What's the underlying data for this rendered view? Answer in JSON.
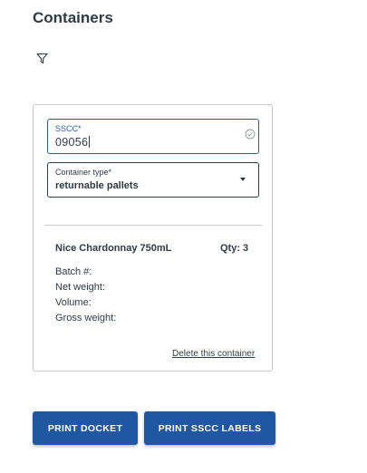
{
  "page": {
    "title": "Containers"
  },
  "card": {
    "sscc": {
      "label": "SSCC*",
      "value": "09056"
    },
    "container_type": {
      "label": "Container type*",
      "value": "returnable pallets"
    },
    "product": {
      "name": "Nice Chardonnay 750mL",
      "qty": "Qty: 3"
    },
    "details": {
      "batch": "Batch #:",
      "net_weight": "Net weight:",
      "volume": "Volume:",
      "gross_weight": "Gross weight:"
    },
    "delete_label": "Delete this container"
  },
  "actions": {
    "print_docket": "PRINT DOCKET",
    "print_sscc": "PRINT SSCC LABELS"
  },
  "colors": {
    "primary_button": "#1f57a3",
    "focus_border": "#2a5aa8",
    "text": "#2f3b45"
  },
  "icons": {
    "filter": "filter-icon",
    "valid": "check-circle-icon",
    "dropdown": "chevron-down-icon"
  }
}
